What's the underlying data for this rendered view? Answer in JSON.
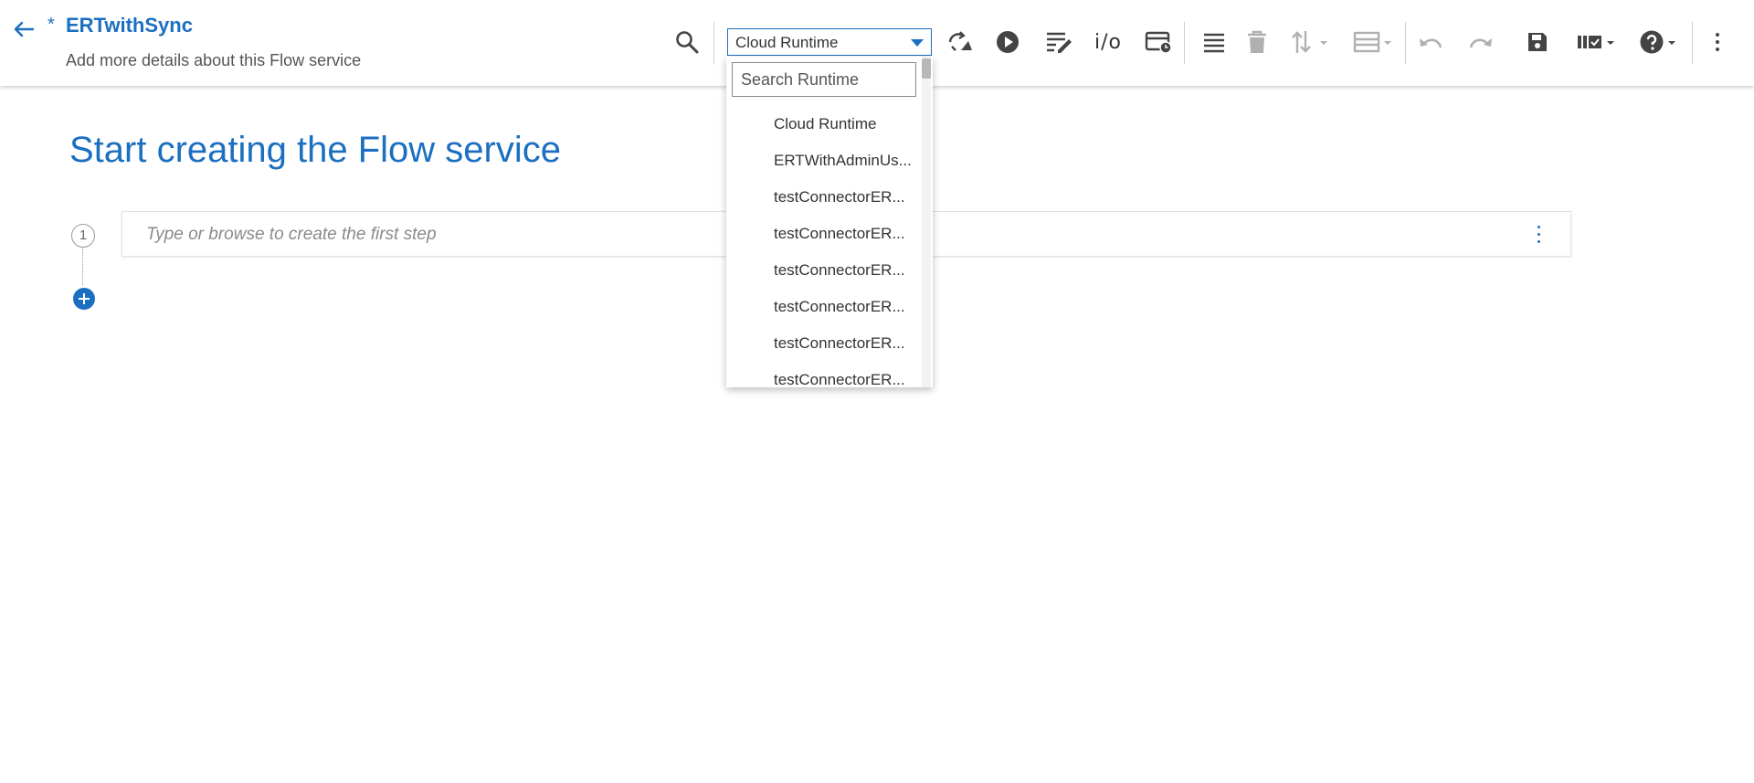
{
  "header": {
    "dirty_marker": "*",
    "title": "ERTwithSync",
    "subtitle": "Add more details about this Flow service"
  },
  "toolbar": {
    "runtime_select_value": "Cloud Runtime",
    "io_label": "i/o"
  },
  "runtime_dropdown": {
    "search_placeholder": "Search Runtime",
    "items": [
      "Cloud Runtime",
      "ERTWithAdminUs...",
      "testConnectorER...",
      "testConnectorER...",
      "testConnectorER...",
      "testConnectorER...",
      "testConnectorER...",
      "testConnectorER..."
    ]
  },
  "main": {
    "heading": "Start creating the Flow service",
    "step_number": "1",
    "step_placeholder": "Type or browse to create the first step"
  },
  "colors": {
    "accent": "#1b6fc1",
    "text": "#333333",
    "icon": "#444444",
    "icon_disabled": "#b0b0b0"
  }
}
